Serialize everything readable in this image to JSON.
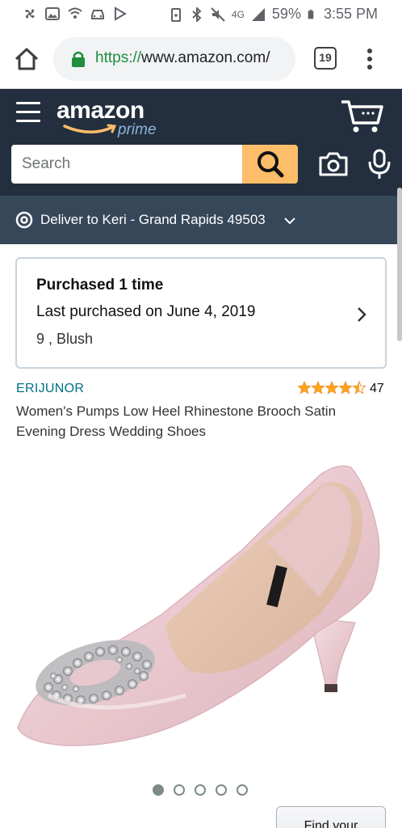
{
  "status_bar": {
    "battery": "59%",
    "time": "3:55 PM",
    "network": "4G"
  },
  "browser": {
    "url_scheme": "https://",
    "url_rest": "www.amazon.com/",
    "tab_count": "19"
  },
  "header": {
    "logo_word": "amazon",
    "logo_sub": "prime",
    "search_placeholder": "Search"
  },
  "deliver": {
    "text": "Deliver to Keri - Grand Rapids 49503"
  },
  "purchased": {
    "title": "Purchased 1 time",
    "last_purchased": "Last purchased on June 4, 2019",
    "variant": "9 , Blush"
  },
  "product": {
    "brand": "ERIJUNOR",
    "rating": 4.5,
    "review_count": "47",
    "title": "Women's Pumps Low Heel Rhinestone Brooch Satin Evening Dress Wedding Shoes"
  },
  "carousel": {
    "total": 5,
    "active_index": 0
  },
  "bottom": {
    "find_button": "Find your"
  },
  "colors": {
    "header_bg": "#232f3e",
    "deliver_bg": "#37475a",
    "search_button": "#febd69",
    "brand_link": "#007185",
    "star": "#ffa41c",
    "secure_green": "#1e8e3e"
  },
  "icons": {
    "home": "home-icon",
    "lock": "lock-icon",
    "menu": "kebab-menu-icon",
    "hamburger": "hamburger-icon",
    "cart": "cart-icon",
    "search": "search-icon",
    "camera": "camera-icon",
    "mic": "mic-icon",
    "location": "location-pin-icon",
    "chevron": "chevron-right-icon"
  }
}
